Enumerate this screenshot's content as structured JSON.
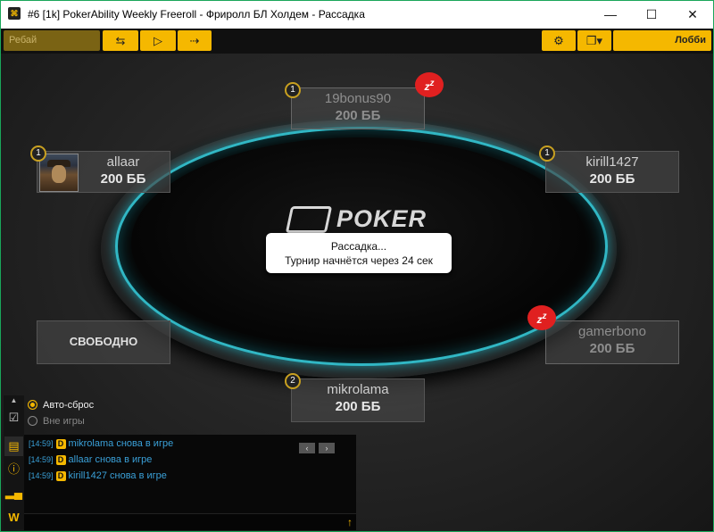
{
  "window": {
    "title": "#6 [1k] PokerAbility Weekly Freeroll - Фриролл БЛ Холдем - Рассадка",
    "icon": "app-icon",
    "controls": [
      "minimize-icon",
      "maximize-icon",
      "close-icon"
    ]
  },
  "toolbar": {
    "rebuy_label": "Ребай",
    "buttons": [
      "refresh-icon",
      "play-icon",
      "exit-icon"
    ],
    "settings_icon": "gear-icon",
    "tables_icon": "tables-dropdown-icon",
    "lobby_label": "Лобби",
    "accent_color": "#f5b800"
  },
  "table": {
    "logo_text": "POKER",
    "rim_color": "#31b7c4",
    "notice": {
      "line1": "Рассадка...",
      "line2": "Турнир начнётся через 24 сек"
    }
  },
  "seats": [
    {
      "name": "19bonus90",
      "stack": "200 ББ",
      "badge": "1",
      "sitting_out": true,
      "sleep_icon": "zz-icon"
    },
    {
      "name": "allaar",
      "stack": "200 ББ",
      "badge": "1",
      "sitting_out": false,
      "avatar": "avatar"
    },
    {
      "name": "kirill1427",
      "stack": "200 ББ",
      "badge": "1",
      "sitting_out": false
    },
    {
      "name": "СВОБОДНО",
      "empty": true
    },
    {
      "name": "gamerbono",
      "stack": "200 ББ",
      "sitting_out": true,
      "sleep_icon": "zz-icon"
    },
    {
      "name": "mikrolama",
      "stack": "200 ББ",
      "badge": "2",
      "sitting_out": false
    }
  ],
  "options": {
    "auto_reset_label": "Авто-сброс",
    "out_of_game_label": "Вне игры",
    "selected": "Авто-сброс"
  },
  "sidebar_icons": [
    "collapse-arrow-icon",
    "checklist-icon",
    "chat-icon",
    "info-icon",
    "stats-icon",
    "w-icon"
  ],
  "chat": {
    "messages": [
      {
        "time": "[14:59]",
        "badge": "D",
        "text": "mikrolama  снова в игре"
      },
      {
        "time": "[14:59]",
        "badge": "D",
        "text": "allaar  снова в игре"
      },
      {
        "time": "[14:59]",
        "badge": "D",
        "text": "kirill1427  снова в игре"
      }
    ],
    "nav": [
      "‹",
      "›"
    ],
    "send_icon": "send-arrow-icon",
    "message_color": "#3aa0d8"
  }
}
